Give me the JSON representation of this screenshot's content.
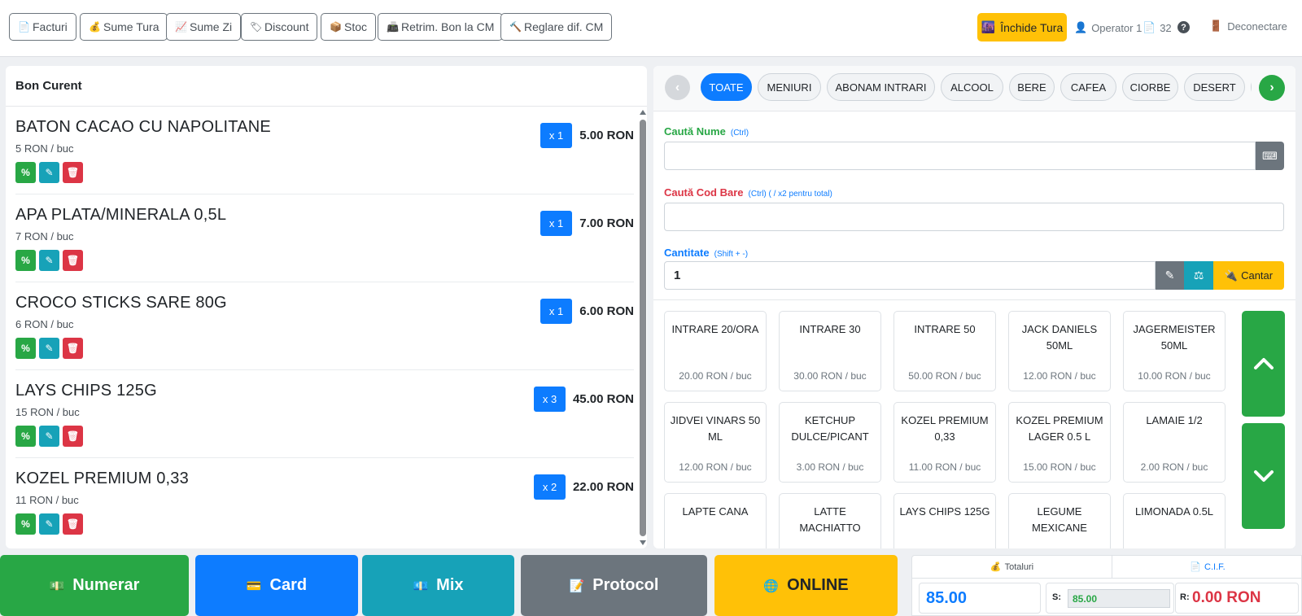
{
  "toolbar": {
    "buttons": [
      {
        "label": "Facturi",
        "icon": "📄"
      },
      {
        "label": "Sume Tura",
        "icon": "💰"
      },
      {
        "label": "Sume Zi",
        "icon": "📈"
      },
      {
        "label": "Discount",
        "icon": "🏷"
      },
      {
        "label": "Stoc",
        "icon": "📦"
      },
      {
        "label": "Retrim. Bon la CM",
        "icon": "📠"
      },
      {
        "label": "Reglare dif. CM",
        "icon": "🔨"
      }
    ],
    "close_shift": {
      "label": "Închide Tura",
      "icon": "🌆"
    },
    "operator": "Operator 1",
    "receipt_count": "32",
    "help": "?",
    "logout": "Deconectare"
  },
  "cart": {
    "title": "Bon Curent",
    "items": [
      {
        "name": "BATON CACAO CU NAPOLITANE",
        "unit_price": "5 RON / buc",
        "qty": "x 1",
        "total": "5.00 RON"
      },
      {
        "name": "APA PLATA/MINERALA 0,5L",
        "unit_price": "7 RON / buc",
        "qty": "x 1",
        "total": "7.00 RON"
      },
      {
        "name": "CROCO STICKS SARE 80G",
        "unit_price": "6 RON / buc",
        "qty": "x 1",
        "total": "6.00 RON"
      },
      {
        "name": "LAYS CHIPS 125G",
        "unit_price": "15 RON / buc",
        "qty": "x 3",
        "total": "45.00 RON"
      },
      {
        "name": "KOZEL PREMIUM 0,33",
        "unit_price": "11 RON / buc",
        "qty": "x 2",
        "total": "22.00 RON"
      }
    ],
    "action_labels": {
      "discount": "%",
      "edit": "✎",
      "delete": "🗑"
    }
  },
  "categories": [
    "TOATE",
    "MENIURI",
    "ABONAM INTRARI",
    "ALCOOL",
    "BERE",
    "CAFEA",
    "CIORBE",
    "DESERT"
  ],
  "active_category": "TOATE",
  "search": {
    "name_label": "Caută Nume",
    "name_hint": "(Ctrl)",
    "name_value": "",
    "barcode_label": "Caută Cod Bare",
    "barcode_hint": "(Ctrl) ( / x2 pentru total)",
    "barcode_value": "",
    "qty_label": "Cantitate",
    "qty_hint": "(Shift + -)",
    "qty_value": "1",
    "cantar_label": "Cantar"
  },
  "products": [
    {
      "name": "INTRARE 20/ORA",
      "price": "20.00 RON / buc"
    },
    {
      "name": "INTRARE 30",
      "price": "30.00 RON / buc"
    },
    {
      "name": "INTRARE 50",
      "price": "50.00 RON / buc"
    },
    {
      "name": "JACK DANIELS 50ML",
      "price": "12.00 RON / buc"
    },
    {
      "name": "JAGERMEISTER 50ML",
      "price": "10.00 RON / buc"
    },
    {
      "name": "JIDVEI VINARS 50 ML",
      "price": "12.00 RON / buc"
    },
    {
      "name": "KETCHUP DULCE/PICANT",
      "price": "3.00 RON / buc"
    },
    {
      "name": "KOZEL PREMIUM 0,33",
      "price": "11.00 RON / buc"
    },
    {
      "name": "KOZEL PREMIUM LAGER 0.5 L",
      "price": "15.00 RON / buc"
    },
    {
      "name": "LAMAIE 1/2",
      "price": "2.00 RON / buc"
    },
    {
      "name": "LAPTE CANA",
      "price": ""
    },
    {
      "name": "LATTE MACHIATTO",
      "price": ""
    },
    {
      "name": "LAYS CHIPS 125G",
      "price": ""
    },
    {
      "name": "LEGUME MEXICANE",
      "price": ""
    },
    {
      "name": "LIMONADA 0.5L",
      "price": ""
    }
  ],
  "payments": [
    {
      "label": "Numerar",
      "icon": "💵"
    },
    {
      "label": "Card",
      "icon": "💳"
    },
    {
      "label": "Mix",
      "icon": "💶"
    },
    {
      "label": "Protocol",
      "icon": "📝"
    },
    {
      "label": "ONLINE",
      "icon": "🌐"
    }
  ],
  "totals": {
    "tab_totals": "Totaluri",
    "tab_totals_icon": "💰",
    "tab_cif": "C.I.F.",
    "tab_cif_icon": "📄",
    "total": "85.00",
    "s_label": "S:",
    "s_value": "85.00",
    "r_label": "R:",
    "r_value": "0.00 RON"
  },
  "colors": {
    "primary": "#0d7cff",
    "success": "#28a745",
    "info": "#17a2b8",
    "danger": "#dc3545",
    "warning": "#ffc107",
    "secondary": "#6c757d"
  }
}
